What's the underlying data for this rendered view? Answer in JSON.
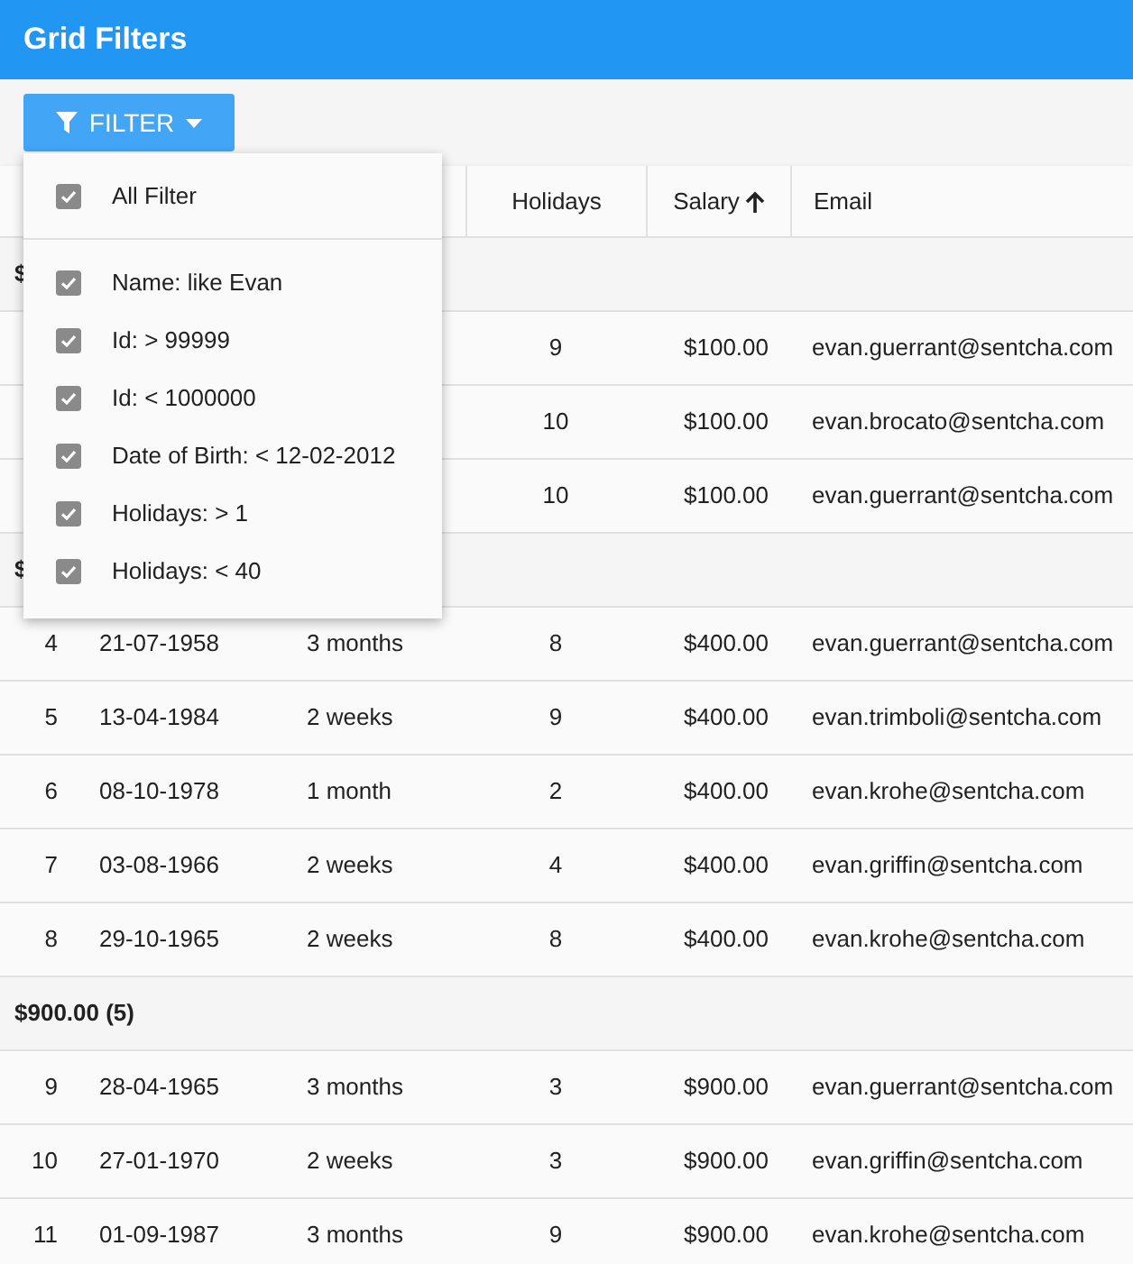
{
  "window": {
    "title": "Grid Filters"
  },
  "toolbar": {
    "filter_button": {
      "label": "FILTER"
    }
  },
  "filter_menu": {
    "all": {
      "label": "All Filter",
      "checked": true
    },
    "items": [
      {
        "label": "Name: like Evan",
        "checked": true
      },
      {
        "label": "Id: > 99999",
        "checked": true
      },
      {
        "label": "Id: < 1000000",
        "checked": true
      },
      {
        "label": "Date of Birth: < 12-02-2012",
        "checked": true
      },
      {
        "label": "Holidays: > 1",
        "checked": true
      },
      {
        "label": "Holidays: < 40",
        "checked": true
      }
    ]
  },
  "table": {
    "columns": [
      {
        "label": "Holidays",
        "sorted": false
      },
      {
        "label": "Salary",
        "sorted": true
      },
      {
        "label": "Email",
        "sorted": false
      }
    ],
    "groups": [
      {
        "label": "$",
        "rows": [
          {
            "holidays": "9",
            "salary": "$100.00",
            "email": "evan.guerrant@sentcha.com"
          },
          {
            "holidays": "10",
            "salary": "$100.00",
            "email": "evan.brocato@sentcha.com"
          },
          {
            "holidays": "10",
            "salary": "$100.00",
            "email": "evan.guerrant@sentcha.com"
          }
        ]
      },
      {
        "label": "$",
        "rows": [
          {
            "id": "4",
            "dob": "21-07-1958",
            "column_3": "3 months",
            "holidays": "8",
            "salary": "$400.00",
            "email": "evan.guerrant@sentcha.com"
          },
          {
            "id": "5",
            "dob": "13-04-1984",
            "column_3": "2 weeks",
            "holidays": "9",
            "salary": "$400.00",
            "email": "evan.trimboli@sentcha.com"
          },
          {
            "id": "6",
            "dob": "08-10-1978",
            "column_3": "1 month",
            "holidays": "2",
            "salary": "$400.00",
            "email": "evan.krohe@sentcha.com"
          },
          {
            "id": "7",
            "dob": "03-08-1966",
            "column_3": "2 weeks",
            "holidays": "4",
            "salary": "$400.00",
            "email": "evan.griffin@sentcha.com"
          },
          {
            "id": "8",
            "dob": "29-10-1965",
            "column_3": "2 weeks",
            "holidays": "8",
            "salary": "$400.00",
            "email": "evan.krohe@sentcha.com"
          }
        ]
      },
      {
        "label": "$900.00 (5)",
        "rows": [
          {
            "id": "9",
            "dob": "28-04-1965",
            "column_3": "3 months",
            "holidays": "3",
            "salary": "$900.00",
            "email": "evan.guerrant@sentcha.com"
          },
          {
            "id": "10",
            "dob": "27-01-1970",
            "column_3": "2 weeks",
            "holidays": "3",
            "salary": "$900.00",
            "email": "evan.griffin@sentcha.com"
          },
          {
            "id": "11",
            "dob": "01-09-1987",
            "column_3": "3 months",
            "holidays": "9",
            "salary": "$900.00",
            "email": "evan.krohe@sentcha.com"
          }
        ]
      }
    ]
  }
}
